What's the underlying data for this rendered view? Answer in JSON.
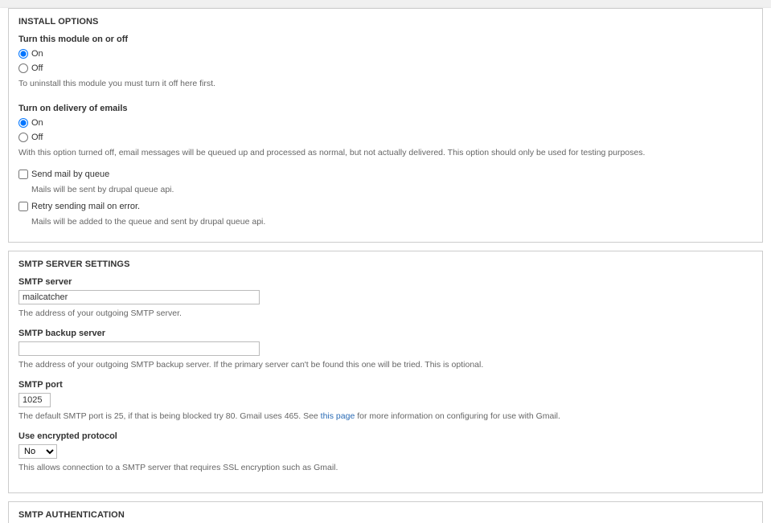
{
  "install_options": {
    "title": "INSTALL OPTIONS",
    "module_toggle": {
      "label": "Turn this module on or off",
      "on_label": "On",
      "off_label": "Off",
      "description": "To uninstall this module you must turn it off here first."
    },
    "delivery_toggle": {
      "label": "Turn on delivery of emails",
      "on_label": "On",
      "off_label": "Off",
      "description": "With this option turned off, email messages will be queued up and processed as normal, but not actually delivered. This option should only be used for testing purposes."
    },
    "send_by_queue": {
      "label": "Send mail by queue",
      "description": "Mails will be sent by drupal queue api."
    },
    "retry_on_error": {
      "label": "Retry sending mail on error.",
      "description": "Mails will be added to the queue and sent by drupal queue api."
    }
  },
  "smtp_server": {
    "title": "SMTP SERVER SETTINGS",
    "server": {
      "label": "SMTP server",
      "value": "mailcatcher",
      "description": "The address of your outgoing SMTP server."
    },
    "backup": {
      "label": "SMTP backup server",
      "value": "",
      "description": "The address of your outgoing SMTP backup server. If the primary server can't be found this one will be tried. This is optional."
    },
    "port": {
      "label": "SMTP port",
      "value": "1025",
      "description_pre": "The default SMTP port is 25, if that is being blocked try 80. Gmail uses 465. See ",
      "link_text": "this page",
      "description_post": " for more information on configuring for use with Gmail."
    },
    "encrypted": {
      "label": "Use encrypted protocol",
      "value": "No",
      "description": "This allows connection to a SMTP server that requires SSL encryption such as Gmail."
    }
  },
  "smtp_auth": {
    "title": "SMTP AUTHENTICATION"
  }
}
